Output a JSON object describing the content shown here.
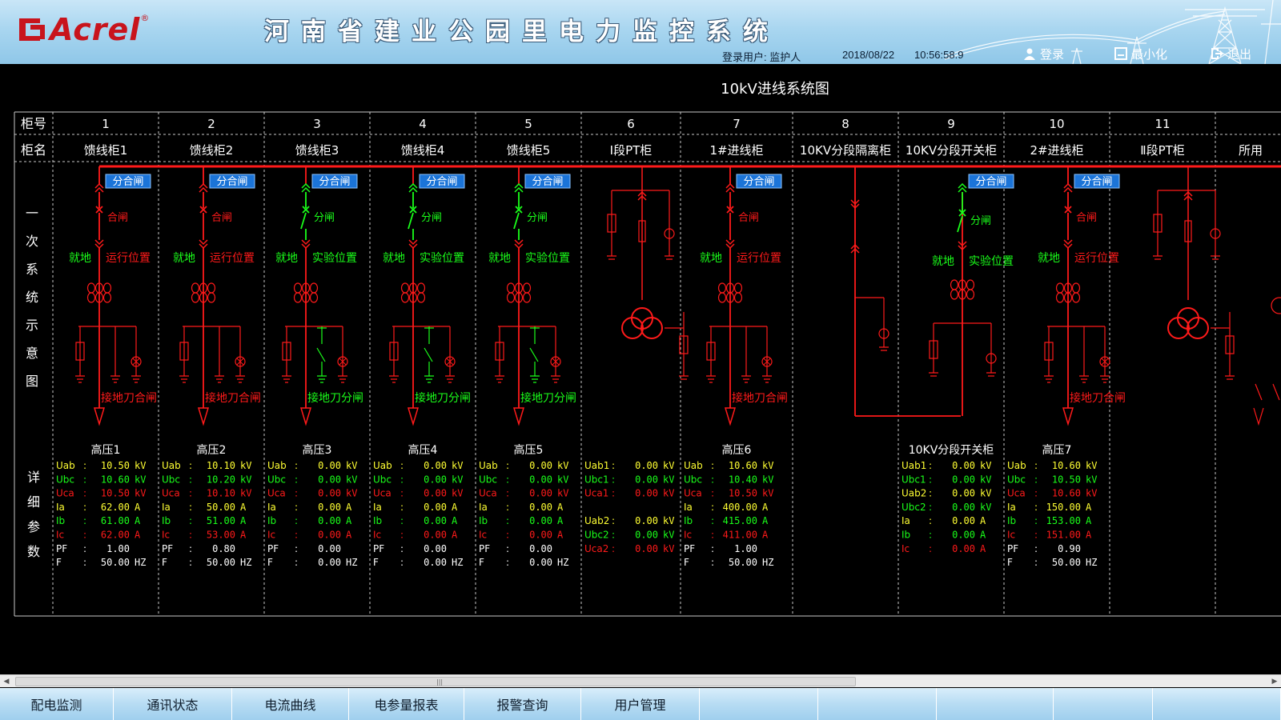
{
  "header": {
    "logo": "Acrel",
    "title": "河南省建业公园里电力监控系统",
    "login_user": "登录用户: 监护人",
    "date": "2018/08/22",
    "time": "10:56:58.9",
    "buttons": {
      "login": "登录",
      "minimize": "最小化",
      "exit": "退出"
    }
  },
  "diagram": {
    "title": "10kV进线系统图",
    "row_labels": {
      "cabinet_no": "柜号",
      "cabinet_name": "柜名",
      "primary": [
        "一",
        "次",
        "系",
        "统",
        "示",
        "意",
        "图"
      ],
      "details": [
        "详",
        "细",
        "参",
        "数"
      ]
    },
    "cabinets": [
      {
        "no": "1",
        "name": "馈线柜1",
        "type": "feeder",
        "switch_btn": "分合闸",
        "breaker": "合闸",
        "breaker_state": "closed",
        "local": "就地",
        "position": "运行位置",
        "position_state": "run",
        "earth": "接地刀合闸",
        "earth_state": "closed",
        "meter": "高压1",
        "params": [
          [
            "Uab",
            "10.50",
            "kV"
          ],
          [
            "Ubc",
            "10.60",
            "kV"
          ],
          [
            "Uca",
            "10.50",
            "kV"
          ],
          [
            "Ia",
            "62.00",
            "A"
          ],
          [
            "Ib",
            "61.00",
            "A"
          ],
          [
            "Ic",
            "62.00",
            "A"
          ],
          [
            "PF",
            "1.00",
            ""
          ],
          [
            "F",
            "50.00",
            "HZ"
          ]
        ]
      },
      {
        "no": "2",
        "name": "馈线柜2",
        "type": "feeder",
        "switch_btn": "分合闸",
        "breaker": "合闸",
        "breaker_state": "closed",
        "local": "就地",
        "position": "运行位置",
        "position_state": "run",
        "earth": "接地刀合闸",
        "earth_state": "closed",
        "meter": "高压2",
        "params": [
          [
            "Uab",
            "10.10",
            "kV"
          ],
          [
            "Ubc",
            "10.20",
            "kV"
          ],
          [
            "Uca",
            "10.10",
            "kV"
          ],
          [
            "Ia",
            "50.00",
            "A"
          ],
          [
            "Ib",
            "51.00",
            "A"
          ],
          [
            "Ic",
            "53.00",
            "A"
          ],
          [
            "PF",
            "0.80",
            ""
          ],
          [
            "F",
            "50.00",
            "HZ"
          ]
        ]
      },
      {
        "no": "3",
        "name": "馈线柜3",
        "type": "feeder",
        "switch_btn": "分合闸",
        "breaker": "分闸",
        "breaker_state": "open",
        "local": "就地",
        "position": "实验位置",
        "position_state": "test",
        "earth": "接地刀分闸",
        "earth_state": "open",
        "meter": "高压3",
        "params": [
          [
            "Uab",
            "0.00",
            "kV"
          ],
          [
            "Ubc",
            "0.00",
            "kV"
          ],
          [
            "Uca",
            "0.00",
            "kV"
          ],
          [
            "Ia",
            "0.00",
            "A"
          ],
          [
            "Ib",
            "0.00",
            "A"
          ],
          [
            "Ic",
            "0.00",
            "A"
          ],
          [
            "PF",
            "0.00",
            ""
          ],
          [
            "F",
            "0.00",
            "HZ"
          ]
        ]
      },
      {
        "no": "4",
        "name": "馈线柜4",
        "type": "feeder",
        "switch_btn": "分合闸",
        "breaker": "分闸",
        "breaker_state": "open",
        "local": "就地",
        "position": "实验位置",
        "position_state": "test",
        "earth": "接地刀分闸",
        "earth_state": "open",
        "meter": "高压4",
        "params": [
          [
            "Uab",
            "0.00",
            "kV"
          ],
          [
            "Ubc",
            "0.00",
            "kV"
          ],
          [
            "Uca",
            "0.00",
            "kV"
          ],
          [
            "Ia",
            "0.00",
            "A"
          ],
          [
            "Ib",
            "0.00",
            "A"
          ],
          [
            "Ic",
            "0.00",
            "A"
          ],
          [
            "PF",
            "0.00",
            ""
          ],
          [
            "F",
            "0.00",
            "HZ"
          ]
        ]
      },
      {
        "no": "5",
        "name": "馈线柜5",
        "type": "feeder",
        "switch_btn": "分合闸",
        "breaker": "分闸",
        "breaker_state": "open",
        "local": "就地",
        "position": "实验位置",
        "position_state": "test",
        "earth": "接地刀分闸",
        "earth_state": "open",
        "meter": "高压5",
        "params": [
          [
            "Uab",
            "0.00",
            "kV"
          ],
          [
            "Ubc",
            "0.00",
            "kV"
          ],
          [
            "Uca",
            "0.00",
            "kV"
          ],
          [
            "Ia",
            "0.00",
            "A"
          ],
          [
            "Ib",
            "0.00",
            "A"
          ],
          [
            "Ic",
            "0.00",
            "A"
          ],
          [
            "PF",
            "0.00",
            ""
          ],
          [
            "F",
            "0.00",
            "HZ"
          ]
        ]
      },
      {
        "no": "6",
        "name": "Ⅰ段PT柜",
        "type": "pt",
        "meter": "",
        "params": [
          [
            "Uab1",
            "0.00",
            "kV"
          ],
          [
            "Ubc1",
            "0.00",
            "kV"
          ],
          [
            "Uca1",
            "0.00",
            "kV"
          ],
          [
            "",
            "",
            ""
          ],
          [
            "Uab2",
            "0.00",
            "kV"
          ],
          [
            "Ubc2",
            "0.00",
            "kV"
          ],
          [
            "Uca2",
            "0.00",
            "kV"
          ]
        ]
      },
      {
        "no": "7",
        "name": "1#进线柜",
        "type": "incoming",
        "switch_btn": "分合闸",
        "breaker": "合闸",
        "breaker_state": "closed",
        "local": "就地",
        "position": "运行位置",
        "position_state": "run",
        "earth": "接地刀合闸",
        "earth_state": "closed",
        "meter": "高压6",
        "params": [
          [
            "Uab",
            "10.60",
            "kV"
          ],
          [
            "Ubc",
            "10.40",
            "kV"
          ],
          [
            "Uca",
            "10.50",
            "kV"
          ],
          [
            "Ia",
            "400.00",
            "A"
          ],
          [
            "Ib",
            "415.00",
            "A"
          ],
          [
            "Ic",
            "411.00",
            "A"
          ],
          [
            "PF",
            "1.00",
            ""
          ],
          [
            "F",
            "50.00",
            "HZ"
          ]
        ]
      },
      {
        "no": "8",
        "name": "10KV分段隔离柜",
        "type": "isolator",
        "meter": "",
        "params": []
      },
      {
        "no": "9",
        "name": "10KV分段开关柜",
        "type": "bus-tie",
        "switch_btn": "分合闸",
        "breaker": "分闸",
        "breaker_state": "open",
        "local": "就地",
        "position": "实验位置",
        "position_state": "test",
        "meter": "10KV分段开关柜",
        "params": [
          [
            "Uab1",
            "0.00",
            "kV"
          ],
          [
            "Ubc1",
            "0.00",
            "kV"
          ],
          [
            "Uab2",
            "0.00",
            "kV"
          ],
          [
            "Ubc2",
            "0.00",
            "kV"
          ],
          [
            "Ia",
            "0.00",
            "A"
          ],
          [
            "Ib",
            "0.00",
            "A"
          ],
          [
            "Ic",
            "0.00",
            "A"
          ]
        ]
      },
      {
        "no": "10",
        "name": "2#进线柜",
        "type": "incoming",
        "switch_btn": "分合闸",
        "breaker": "合闸",
        "breaker_state": "closed",
        "local": "就地",
        "position": "运行位置",
        "position_state": "run",
        "earth": "接地刀合闸",
        "earth_state": "closed",
        "meter": "高压7",
        "params": [
          [
            "Uab",
            "10.60",
            "kV"
          ],
          [
            "Ubc",
            "10.50",
            "kV"
          ],
          [
            "Uca",
            "10.60",
            "kV"
          ],
          [
            "Ia",
            "150.00",
            "A"
          ],
          [
            "Ib",
            "153.00",
            "A"
          ],
          [
            "Ic",
            "151.00",
            "A"
          ],
          [
            "PF",
            "0.90",
            ""
          ],
          [
            "F",
            "50.00",
            "HZ"
          ]
        ]
      },
      {
        "no": "11",
        "name": "Ⅱ段PT柜",
        "type": "pt",
        "meter": "",
        "params": []
      },
      {
        "no": "",
        "name": "所用",
        "type": "partial",
        "meter": "",
        "params": []
      }
    ]
  },
  "nav": [
    "配电监测",
    "通讯状态",
    "电流曲线",
    "电参量报表",
    "报警查询",
    "用户管理",
    "",
    "",
    "",
    "",
    ""
  ],
  "colors": {
    "red": "#ff1a1a",
    "green": "#1aff1a",
    "yellow": "#ffff33",
    "white": "#ffffff",
    "btn_blue": "#1b74d8",
    "grid": "#c8c8c8"
  }
}
